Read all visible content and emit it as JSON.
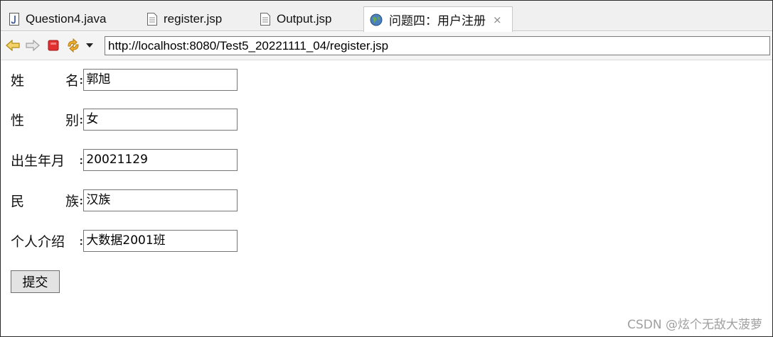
{
  "tabs": [
    {
      "label": "Question4.java",
      "icon": "java-file-icon"
    },
    {
      "label": "register.jsp",
      "icon": "jsp-file-icon"
    },
    {
      "label": "Output.jsp",
      "icon": "jsp-file-icon"
    },
    {
      "label": "问题四：用户注册",
      "icon": "globe-icon",
      "active": true,
      "close": "⨯"
    }
  ],
  "navbar": {
    "url": "http://localhost:8080/Test5_20221111_04/register.jsp"
  },
  "form": {
    "rows": [
      {
        "label_a": "姓",
        "label_b": "名",
        "colon": ":",
        "value": "郭旭"
      },
      {
        "label_a": "性",
        "label_b": "别",
        "colon": ":",
        "value": "女"
      },
      {
        "label_a": "出生年月",
        "label_b": "",
        "colon": ":",
        "value": "20021129"
      },
      {
        "label_a": "民",
        "label_b": "族",
        "colon": ":",
        "value": "汉族"
      },
      {
        "label_a": "个人介绍",
        "label_b": "",
        "colon": ":",
        "value": "大数据2001班"
      }
    ],
    "submit_label": "提交"
  },
  "watermark": "CSDN @炫个无敌大菠萝",
  "colors": {
    "accent_stop": "#e03030",
    "arrow": "#d8a020",
    "refresh": "#e0a020"
  }
}
